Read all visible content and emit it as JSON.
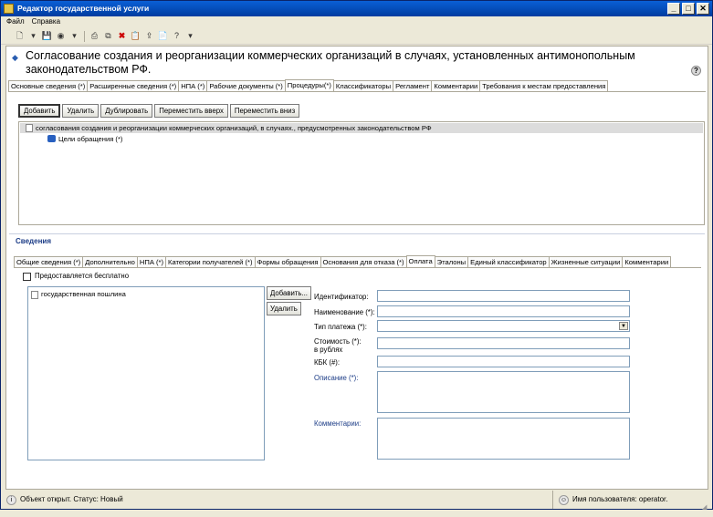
{
  "window": {
    "title": "Редактор государственной услуги",
    "buttons": [
      "_",
      "□",
      "✕"
    ]
  },
  "menu": [
    "Файл",
    "Справка"
  ],
  "toolbar": {
    "icons": [
      "new-icon",
      "save-icon",
      "globe-icon",
      "print-icon",
      "copy-icon",
      "delete-icon",
      "paste-icon",
      "export-icon",
      "document-icon",
      "help-icon"
    ]
  },
  "page": {
    "title": "Согласование создания и реорганизации коммерческих организаций в случаях, установленных антимонопольным законодательством РФ."
  },
  "main_tabs": [
    "Основные сведения (*)",
    "Расширенные сведения (*)",
    "НПА (*)",
    "Рабочие документы (*)",
    "Процедуры(*)",
    "Классификаторы",
    "Регламент",
    "Комментарии",
    "Требования к местам предоставления"
  ],
  "main_tabs_active": 4,
  "actions": {
    "add": "Добавить",
    "delete": "Удалить",
    "duplicate": "Дублировать",
    "move_up": "Переместить вверх",
    "move_down": "Переместить вниз"
  },
  "tree": {
    "root": "согласования создания и реорганизации коммерческих организаций, в случаях., предусмотренных законодательством РФ",
    "child": "Цели обращения (*)"
  },
  "details": {
    "title": "Сведения",
    "tabs": [
      "Общие сведения (*)",
      "Дополнительно",
      "НПА (*)",
      "Категории получателей (*)",
      "Формы обращения",
      "Основания для отказа (*)",
      "Оплата",
      "Эталоны",
      "Единый классификатор",
      "Жизненные ситуации",
      "Комментарии"
    ],
    "tabs_active": 6,
    "free_checkbox": "Предоставляется бесплатно",
    "list_item": "государственная пошлина",
    "add_btn": "Добавить...",
    "delete_btn": "Удалить",
    "fields": {
      "identifier": "Идентификатор:",
      "name": "Наименование (*):",
      "payment_type": "Тип платежа (*):",
      "cost": "Стоимость (*):\nв рублях",
      "kbk": "КБК (#):",
      "description": "Описание (*):",
      "comments": "Комментарии:"
    }
  },
  "status": {
    "left": "Объект открыт. Статус: Новый",
    "right": "Имя пользователя: operator."
  }
}
